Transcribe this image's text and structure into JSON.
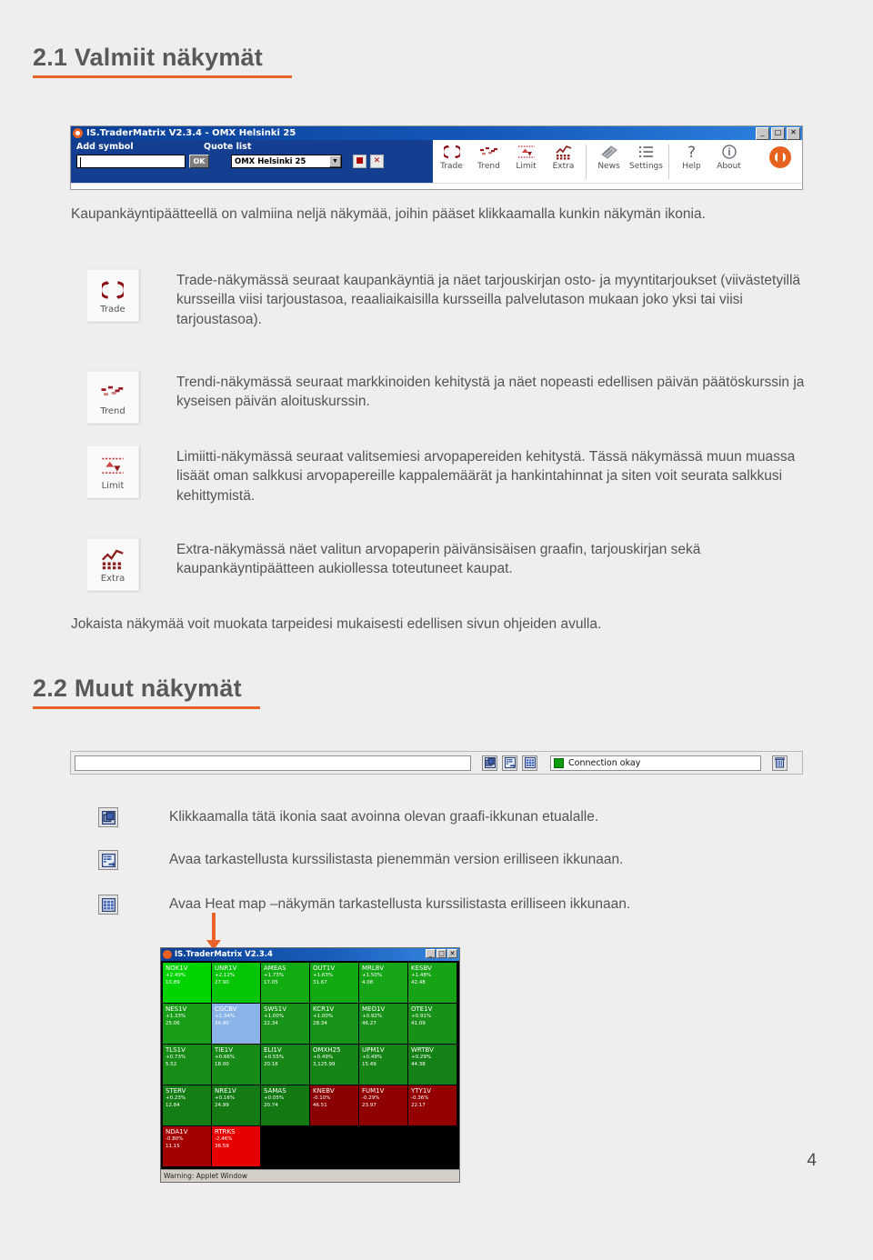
{
  "sections": {
    "s21": {
      "title": "2.1 Valmiit näkymät"
    },
    "s22": {
      "title": "2.2 Muut näkymät"
    }
  },
  "toolbar_shot": {
    "window_title": "IS.TraderMatrix V2.3.4  -  OMX Helsinki 25",
    "label_add_symbol": "Add symbol",
    "label_quote_list": "Quote list",
    "symbol_input_value": "",
    "ok_button": "OK",
    "quote_list_selected": "OMX Helsinki 25",
    "save_button_glyph": "■",
    "delete_button_glyph": "✕",
    "win_minimize": "_",
    "win_maximize": "□",
    "win_close": "✕",
    "tools": [
      {
        "label": "Trade",
        "icon": "trade-icon"
      },
      {
        "label": "Trend",
        "icon": "trend-icon"
      },
      {
        "label": "Limit",
        "icon": "limit-icon"
      },
      {
        "label": "Extra",
        "icon": "extra-icon"
      },
      {
        "label": "News",
        "icon": "news-icon"
      },
      {
        "label": "Settings",
        "icon": "settings-icon"
      },
      {
        "label": "Help",
        "icon": "help-icon"
      },
      {
        "label": "About",
        "icon": "about-icon"
      }
    ]
  },
  "intro": "Kaupankäyntipäätteellä on valmiina neljä näkymää, joihin pääset klikkaamalla kunkin näkymän ikonia.",
  "features": [
    {
      "icon_caption": "Trade",
      "text": "Trade-näkymässä seuraat kaupankäyntiä ja näet tarjouskirjan osto- ja myyntitarjoukset (viivästetyillä kursseilla viisi tarjoustasoa, reaaliaikaisilla kursseilla palvelutason mukaan joko yksi tai viisi tarjoustasoa)."
    },
    {
      "icon_caption": "Trend",
      "text": "Trendi-näkymässä seuraat markkinoiden kehitystä ja näet nopeasti edellisen päivän päätöskurssin ja kyseisen päivän aloituskurssin."
    },
    {
      "icon_caption": "Limit",
      "text": "Limiitti-näkymässä seuraat valitsemiesi arvopapereiden kehitystä. Tässä näkymässä muun muassa lisäät oman salkkusi arvopapereille kappalemäärät ja hankintahinnat ja siten voit seurata salkkusi kehittymistä."
    },
    {
      "icon_caption": "Extra",
      "text": "Extra-näkymässä näet valitun arvopaperin päivänsisäisen graafin, tarjouskirjan sekä kaupankäyntipäätteen aukiollessa toteutuneet kaupat."
    }
  ],
  "closing": "Jokaista näkymää voit muokata tarpeidesi mukaisesti edellisen sivun ohjeiden avulla.",
  "status_shot": {
    "text_field_value": "",
    "connection_status": "Connection okay",
    "connection_led_color": "#0b9c0b",
    "buttons": [
      {
        "icon": "bring-graph-window-to-front-icon"
      },
      {
        "icon": "open-small-quote-list-window-icon"
      },
      {
        "icon": "open-heat-map-window-icon"
      }
    ],
    "trash_icon": "trash-icon"
  },
  "legend": [
    {
      "icon": "bring-graph-window-to-front-icon",
      "text": "Klikkaamalla tätä ikonia saat avoinna olevan graafi-ikkunan etualalle."
    },
    {
      "icon": "open-small-quote-list-window-icon",
      "text": "Avaa tarkastellusta kurssilistasta pienemmän version erilliseen ikkunaan."
    },
    {
      "icon": "open-heat-map-window-icon",
      "text": "Avaa Heat map –näkymän tarkastellusta kurssilistasta erilliseen ikkunaan."
    }
  ],
  "heatmap_shot": {
    "window_title": "IS.TraderMatrix V2.3.4",
    "win_minimize": "_",
    "win_maximize": "□",
    "win_close": "✕",
    "status_text": "Warning: Applet Window",
    "colors": {
      "strong_up": "#00d400",
      "up": "#17a017",
      "mid_up": "#0f8b10",
      "selected": "#8ab4e8",
      "down": "#8b0000",
      "strong_down": "#e00000"
    },
    "rows": [
      [
        {
          "symbol": "NOK1V",
          "pct": "+2.49%",
          "price": "10.89",
          "color": "#00d400"
        },
        {
          "symbol": "UNR1V",
          "pct": "+2.12%",
          "price": "27.90",
          "color": "#06c406"
        },
        {
          "symbol": "AMEAS",
          "pct": "+1.73%",
          "price": "17.05",
          "color": "#13ac13"
        },
        {
          "symbol": "OUT1V",
          "pct": "+1.63%",
          "price": "31.67",
          "color": "#13a913"
        },
        {
          "symbol": "MRL8V",
          "pct": "+1.50%",
          "price": "4.08",
          "color": "#16a516"
        },
        {
          "symbol": "KESBV",
          "pct": "+1.48%",
          "price": "42.48",
          "color": "#16a416"
        }
      ],
      [
        {
          "symbol": "NES1V",
          "pct": "+1.33%",
          "price": "25.06",
          "color": "#189e18"
        },
        {
          "symbol": "CGCBV",
          "pct": "+1.34%",
          "price": "34.90",
          "color": "#8ab4e8"
        },
        {
          "symbol": "SWS1V",
          "pct": "+1.00%",
          "price": "22.34",
          "color": "#189418"
        },
        {
          "symbol": "KCR1V",
          "pct": "+1.00%",
          "price": "28.34",
          "color": "#189418"
        },
        {
          "symbol": "MEO1V",
          "pct": "+0.92%",
          "price": "46.27",
          "color": "#189118"
        },
        {
          "symbol": "OTE1V",
          "pct": "+0.91%",
          "price": "41.09",
          "color": "#189118"
        }
      ],
      [
        {
          "symbol": "TLS1V",
          "pct": "+0.73%",
          "price": "5.52",
          "color": "#178c17"
        },
        {
          "symbol": "TIE1V",
          "pct": "+0.66%",
          "price": "18.00",
          "color": "#178a17"
        },
        {
          "symbol": "ELI1V",
          "pct": "+0.55%",
          "price": "20.16",
          "color": "#178717"
        },
        {
          "symbol": "OMXH25",
          "pct": "+0.49%",
          "price": "3,125.99",
          "color": "#168516"
        },
        {
          "symbol": "UPM1V",
          "pct": "+0.49%",
          "price": "15.49",
          "color": "#168516"
        },
        {
          "symbol": "WRTBV",
          "pct": "+0.29%",
          "price": "44.38",
          "color": "#158015"
        }
      ],
      [
        {
          "symbol": "STERV",
          "pct": "+0.23%",
          "price": "12.84",
          "color": "#147d14"
        },
        {
          "symbol": "NRE1V",
          "pct": "+0.16%",
          "price": "24.99",
          "color": "#147b14"
        },
        {
          "symbol": "SAMAS",
          "pct": "+0.05%",
          "price": "20.74",
          "color": "#137913"
        },
        {
          "symbol": "KNEBV",
          "pct": "-0.10%",
          "price": "46.51",
          "color": "#8b0000"
        },
        {
          "symbol": "FUM1V",
          "pct": "-0.29%",
          "price": "23.97",
          "color": "#900000"
        },
        {
          "symbol": "YTY1V",
          "pct": "-0.36%",
          "price": "22.17",
          "color": "#940000"
        }
      ],
      [
        {
          "symbol": "NDA1V",
          "pct": "-0.80%",
          "price": "11.15",
          "color": "#a30000"
        },
        {
          "symbol": "RTRKS",
          "pct": "-2.46%",
          "price": "36.59",
          "color": "#e60000"
        },
        {
          "symbol": "",
          "pct": "",
          "price": "",
          "color": "#000000"
        },
        {
          "symbol": "",
          "pct": "",
          "price": "",
          "color": "#000000"
        },
        {
          "symbol": "",
          "pct": "",
          "price": "",
          "color": "#000000"
        },
        {
          "symbol": "",
          "pct": "",
          "price": "",
          "color": "#000000"
        }
      ]
    ]
  },
  "page_number": "4"
}
